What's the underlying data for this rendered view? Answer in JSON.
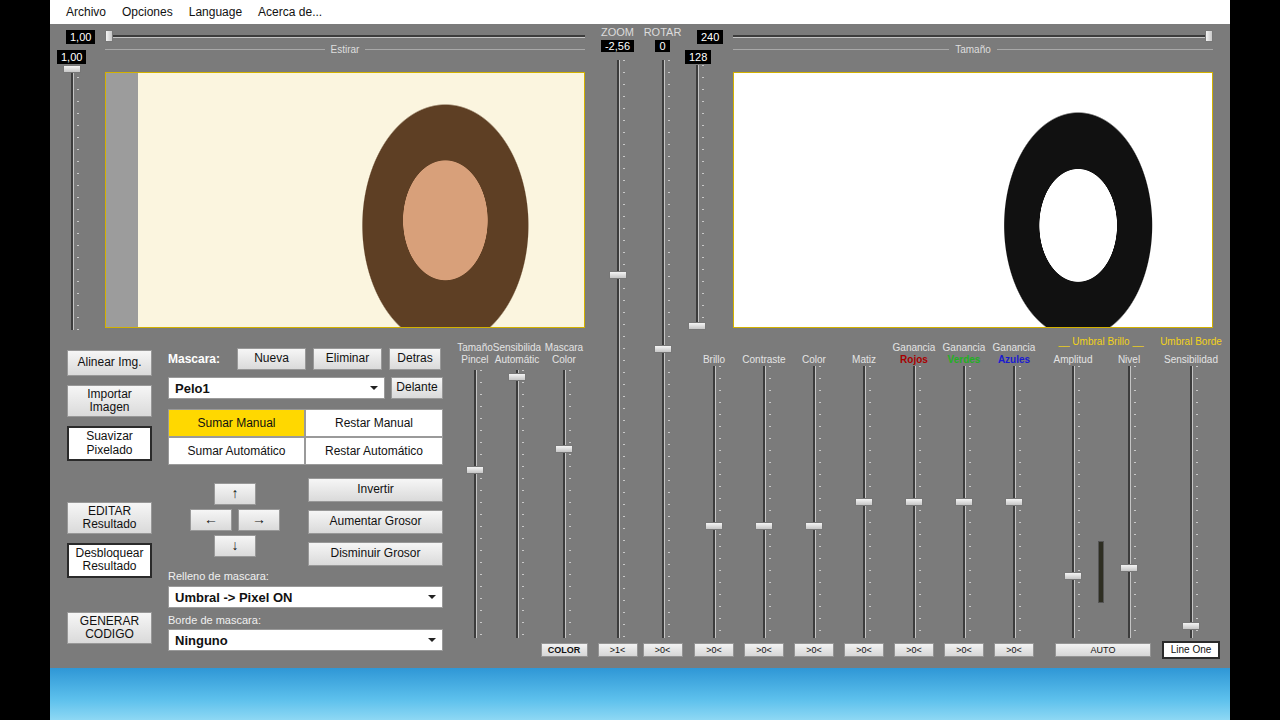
{
  "menu": [
    {
      "label": "Archivo"
    },
    {
      "label": "Opciones"
    },
    {
      "label": "Language"
    },
    {
      "label": "Acerca de..."
    }
  ],
  "source": {
    "stretch": {
      "value": "1,00",
      "label": "Estirar",
      "level": 0.0
    },
    "height": {
      "value": "1,00",
      "level": 1.0
    }
  },
  "transform": [
    {
      "label": "ZOOM",
      "value": "-2,56",
      "level": 0.63,
      "reset": ">1<"
    },
    {
      "label": "ROTAR",
      "value": "0",
      "level": 0.5,
      "reset": ">0<"
    }
  ],
  "result": {
    "size": {
      "value": "240",
      "label": "Tamaño",
      "level": 1.0
    },
    "height": {
      "value": "128",
      "level": 0.0
    }
  },
  "side_buttons": [
    [
      {
        "label": "Alinear Img.",
        "on": false
      },
      {
        "label": "Importar Imagen",
        "on": false
      },
      {
        "label": "Suavizar Pixelado",
        "on": true
      }
    ],
    [
      {
        "label": "EDITAR Resultado",
        "on": false
      },
      {
        "label": "Desbloquear Resultado",
        "on": true
      }
    ],
    [
      {
        "label": "GENERAR CODIGO",
        "on": false
      }
    ]
  ],
  "mask": {
    "label": "Mascara:",
    "actions": [
      "Nueva",
      "Eliminar",
      "Detras"
    ],
    "current": "Pelo1",
    "front": "Delante",
    "modes": [
      {
        "label": "Sumar Manual",
        "selected": true
      },
      {
        "label": "Restar Manual",
        "selected": false
      },
      {
        "label": "Sumar Automático",
        "selected": false
      },
      {
        "label": "Restar Automático",
        "selected": false
      }
    ],
    "arrows": {
      "up": "↑",
      "left": "←",
      "right": "→",
      "down": "↓"
    },
    "tools": [
      "Invertir",
      "Aumentar Grosor",
      "Disminuir Grosor"
    ],
    "fill": {
      "label": "Relleno de mascara:",
      "value": "Umbral -> Pixel ON"
    },
    "border": {
      "label": "Borde de mascara:",
      "value": "Ninguno"
    }
  },
  "brush_sliders": [
    {
      "lines": [
        "Tamaño",
        "Pincel"
      ],
      "level": 0.63
    },
    {
      "lines": [
        "Sensibilida",
        "Automátic"
      ],
      "level": 0.99
    },
    {
      "lines": [
        "Mascara",
        "Color"
      ],
      "level": 0.71,
      "button": "COLOR"
    }
  ],
  "adjust_sliders": [
    {
      "label": "Brillo",
      "level": 0.41,
      "reset": ">0<"
    },
    {
      "label": "Contraste",
      "level": 0.41,
      "reset": ">0<"
    },
    {
      "label": "Color",
      "level": 0.41,
      "reset": ">0<"
    },
    {
      "label": "Matiz",
      "level": 0.5,
      "reset": ">0<"
    },
    {
      "label": "Ganancia",
      "sub": "Rojos",
      "color": "#a80000",
      "level": 0.5,
      "reset": ">0<"
    },
    {
      "label": "Ganancia",
      "sub": "Verdes",
      "color": "#22b022",
      "level": 0.5,
      "reset": ">0<"
    },
    {
      "label": "Ganancia",
      "sub": "Azules",
      "color": "#1a1ad0",
      "level": 0.5,
      "reset": ">0<"
    }
  ],
  "threshold": {
    "brightness": {
      "title": "__ Umbral Brillo __",
      "sliders": [
        {
          "label": "Amplitud",
          "level": 0.22
        },
        {
          "label": "Nivel",
          "level": 0.25
        }
      ],
      "meter": {
        "level": 0.0
      },
      "button": "AUTO"
    },
    "edge": {
      "title": "Umbral Borde",
      "slider": {
        "label": "Sensibilidad",
        "level": 0.03
      },
      "button": {
        "label": "Line One",
        "on": true
      }
    }
  }
}
